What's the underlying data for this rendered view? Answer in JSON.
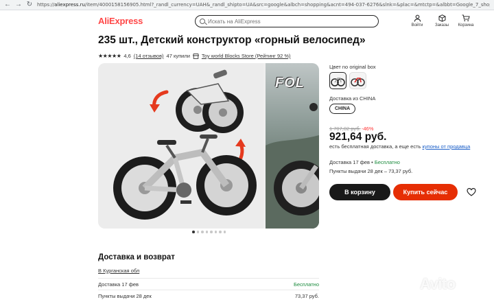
{
  "browser": {
    "url": "https://aliexpress.ru/item/4000158156905.html?_randl_currency=UAH&_randl_shipto=UA&src=google&albch=shopping&acnt=494-037-6276&slnk=&plac=&mtctp=&albbt=Google_7_shopping&albagn=888888&i..."
  },
  "header": {
    "logo": "AliExpress",
    "search_placeholder": "Искать на AliExpress",
    "icons": [
      {
        "label": "Войти",
        "icon": "user-icon"
      },
      {
        "label": "Заказы",
        "icon": "orders-box-icon"
      },
      {
        "label": "Корзина",
        "icon": "cart-icon"
      }
    ]
  },
  "product": {
    "title": "235 шт., Детский конструктор «горный велосипед»",
    "stars": "★★★★★",
    "rating": "4,6",
    "reviews": "(14 отзывов)",
    "bought": "47 купили",
    "store": "Toy world Blocks Store (Рейтинг 92 %)"
  },
  "gallery": {
    "overlay_text": "FOL",
    "dots_count": 8,
    "active_dot": 0
  },
  "options": {
    "color_label": "Цвет no original box",
    "ship_from_label": "Доставка из CHINA",
    "ship_from_value": "CHINA"
  },
  "pricing": {
    "old_price": "1 707,02 руб.",
    "discount": "-46%",
    "price": "921,64 руб.",
    "ship_note": "есть бесплатная доставка, а еще есть",
    "coupons_link": "купоны от продавца"
  },
  "delivery": {
    "line1_prefix": "Доставка 17 фев",
    "line1_sep": " • ",
    "line1_status": "Бесплатно",
    "line2": "Пункты выдачи 28 дек – 73,37 руб."
  },
  "buttons": {
    "cart": "В корзину",
    "buy": "Купить сейчас"
  },
  "section": {
    "title": "Доставка и возврат",
    "region": "В Курганская обл",
    "rows": [
      {
        "label": "Доставка 17 фев",
        "value": "Бесплатно"
      },
      {
        "label": "Пункты выдачи 28 дек",
        "value": "73,37 руб."
      }
    ]
  },
  "watermark": "Avito",
  "colors": {
    "brand": "#ff4747",
    "buy_button": "#e62e04",
    "cart_button": "#191919",
    "discount": "#ff3333",
    "free": "#1a8a3c",
    "link": "#1a5ec8"
  }
}
